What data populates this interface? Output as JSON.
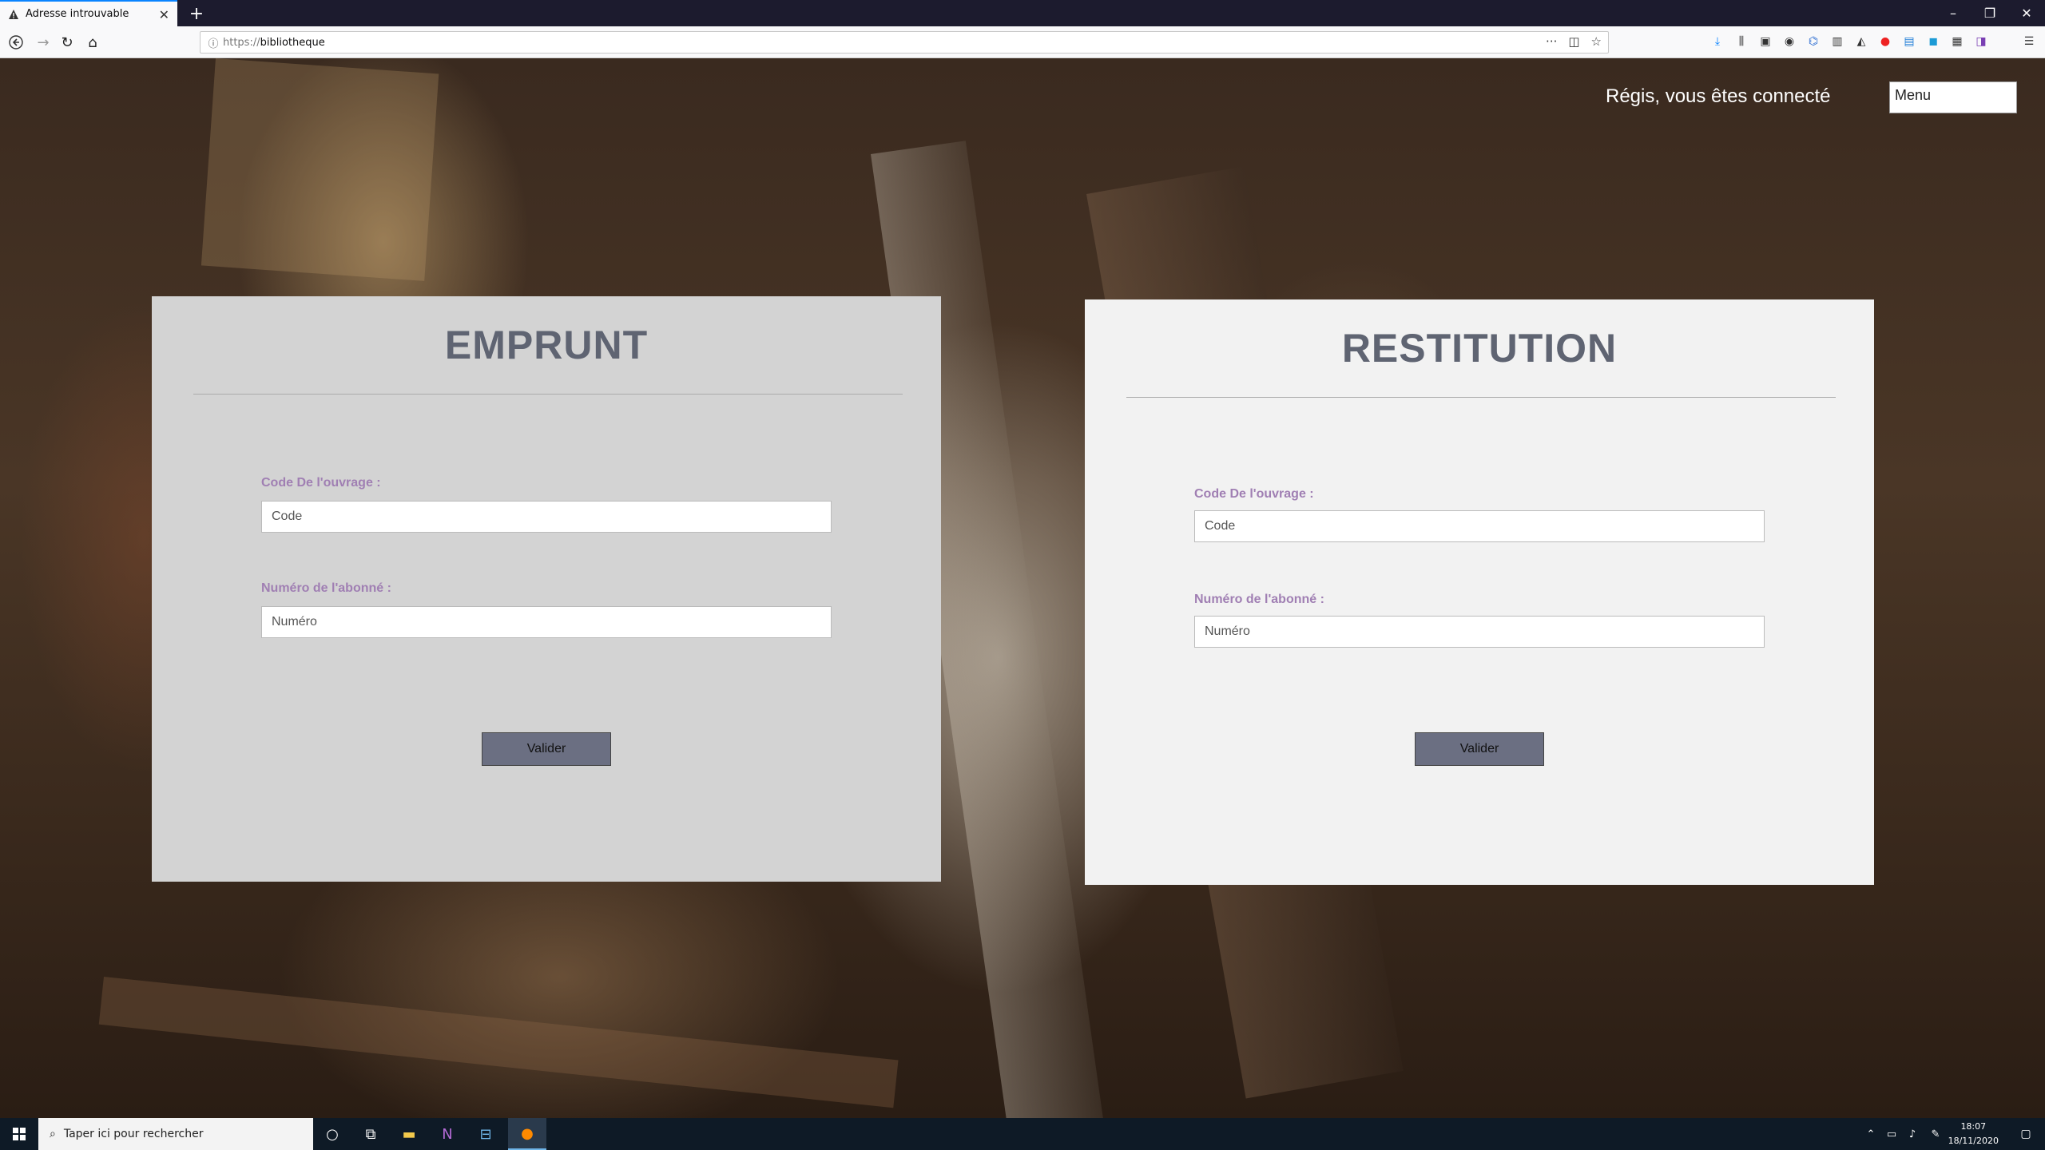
{
  "browser": {
    "tab_title": "Adresse introuvable",
    "url_protocol": "https://",
    "url_host": "bibliotheque"
  },
  "header": {
    "user_status": "Régis, vous êtes connecté",
    "menu_label": "Menu"
  },
  "emprunt": {
    "title": "EMPRUNT",
    "code_label": "Code De l'ouvrage :",
    "code_placeholder": "Code",
    "numero_label": "Numéro de l'abonné :",
    "numero_placeholder": "Numéro",
    "submit_label": "Valider"
  },
  "restitution": {
    "title": "RESTITUTION",
    "code_label": "Code De l'ouvrage :",
    "code_placeholder": "Code",
    "numero_label": "Numéro de l'abonné :",
    "numero_placeholder": "Numéro",
    "submit_label": "Valider"
  },
  "taskbar": {
    "search_placeholder": "Taper ici pour rechercher",
    "time": "18:07",
    "date": "18/11/2020"
  },
  "colors": {
    "accent_label": "#a07fb3",
    "title": "#5f6472",
    "button": "#6b6f82"
  }
}
